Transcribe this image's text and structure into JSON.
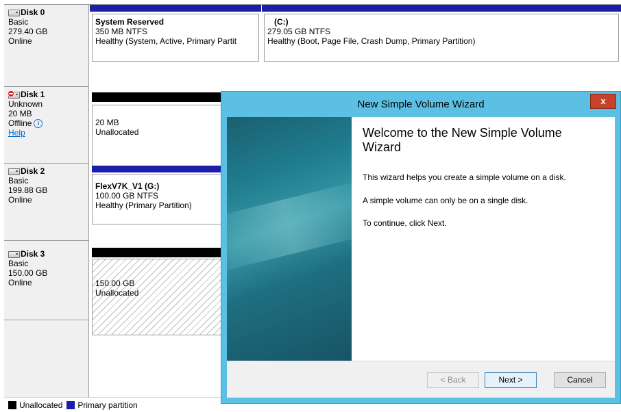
{
  "disks": [
    {
      "name": "Disk 0",
      "type": "Basic",
      "size": "279.40 GB",
      "status": "Online",
      "icon": "disk-icon",
      "partitions": [
        {
          "bar": "blue",
          "title": "System Reserved",
          "detail": "350 MB NTFS",
          "health": "Healthy (System, Active, Primary Partit"
        },
        {
          "bar": "blue",
          "title": "(C:)",
          "detail": "279.05 GB NTFS",
          "health": "Healthy (Boot, Page File, Crash Dump, Primary Partition)"
        }
      ]
    },
    {
      "name": "Disk 1",
      "type": "Unknown",
      "size": "20 MB",
      "status": "Offline",
      "help": "Help",
      "icon": "disk-error-icon",
      "partitions": [
        {
          "bar": "black",
          "size": "20 MB",
          "label": "Unallocated"
        }
      ]
    },
    {
      "name": "Disk 2",
      "type": "Basic",
      "size": "199.88 GB",
      "status": "Online",
      "icon": "disk-icon",
      "partitions": [
        {
          "bar": "blue",
          "title": "FlexV7K_V1  (G:)",
          "detail": "100.00 GB NTFS",
          "health": "Healthy (Primary Partition)"
        }
      ]
    },
    {
      "name": "Disk 3",
      "type": "Basic",
      "size": "150.00 GB",
      "status": "Online",
      "icon": "disk-icon",
      "partitions": [
        {
          "bar": "black",
          "size": "150.00 GB",
          "label": "Unallocated"
        }
      ]
    }
  ],
  "legend": {
    "unallocated": "Unallocated",
    "primary": "Primary partition",
    "colors": {
      "unallocated": "#000000",
      "primary": "#1a1ea8"
    }
  },
  "wizard": {
    "title": "New Simple Volume Wizard",
    "close": "x",
    "heading": "Welcome to the New Simple Volume Wizard",
    "line1": "This wizard helps you create a simple volume on a disk.",
    "line2": "A simple volume can only be on a single disk.",
    "line3": "To continue, click Next.",
    "back": "< Back",
    "next": "Next >",
    "cancel": "Cancel",
    "titlebar_color": "#5bc0e4",
    "close_color": "#c7412b"
  }
}
